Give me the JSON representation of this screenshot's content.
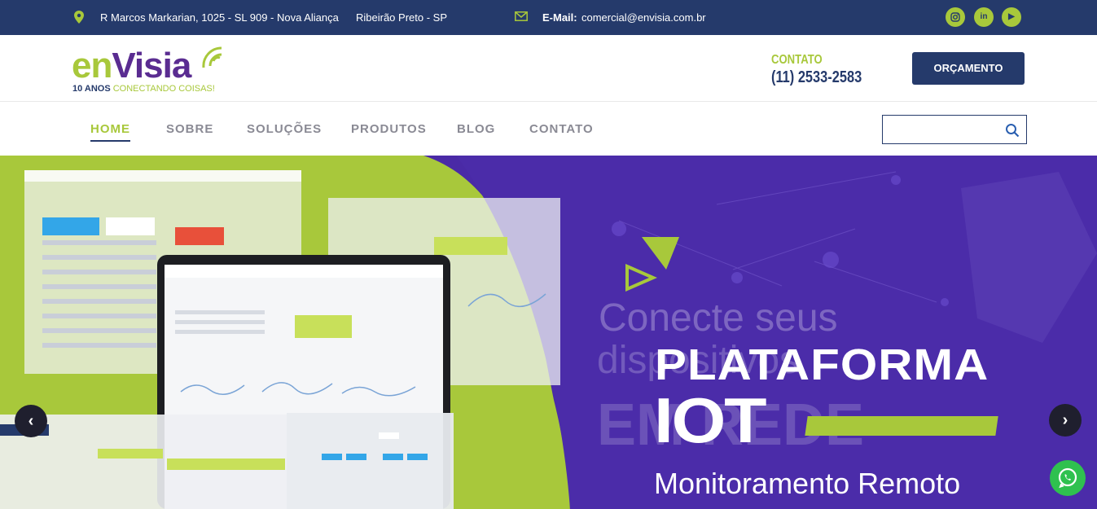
{
  "topbar": {
    "address": "R  Marcos Markarian, 1025 - SL 909 - Nova Aliança",
    "city": "Ribeirão Preto - SP",
    "email_label": "E-Mail:",
    "email_value": "comercial@envisia.com.br",
    "social": [
      {
        "icon": "instagram-icon"
      },
      {
        "icon": "linkedin-icon",
        "glyph": "in"
      },
      {
        "icon": "youtube-icon",
        "glyph": "▶"
      }
    ]
  },
  "header": {
    "logo_en": "en",
    "logo_visia": "Visia",
    "logo_years": "10 ANOS",
    "logo_tagline": "CONECTANDO COISAS!",
    "contact_label": "CONTATO",
    "contact_phone": "(11) 2533-2583",
    "quote_button": "ORÇAMENTO"
  },
  "nav": {
    "items": [
      {
        "label": "HOME",
        "active": true
      },
      {
        "label": "SOBRE",
        "active": false
      },
      {
        "label": "SOLUÇÕES",
        "active": false
      },
      {
        "label": "PRODUTOS",
        "active": false
      },
      {
        "label": "BLOG",
        "active": false
      },
      {
        "label": "CONTATO",
        "active": false
      }
    ],
    "search_placeholder": ""
  },
  "hero": {
    "ghost_line1": "Conecte seus",
    "ghost_line2": "dispositivos",
    "ghost_line3": "EM REDE",
    "title": "PLATAFORMA",
    "highlight": "IOT",
    "subtitle": "Monitoramento Remoto",
    "prev_glyph": "‹",
    "next_glyph": "›"
  },
  "colors": {
    "navy": "#253a6b",
    "lime": "#a8c83b",
    "purple": "#4a2aa6",
    "whatsapp": "#2fc14f"
  }
}
